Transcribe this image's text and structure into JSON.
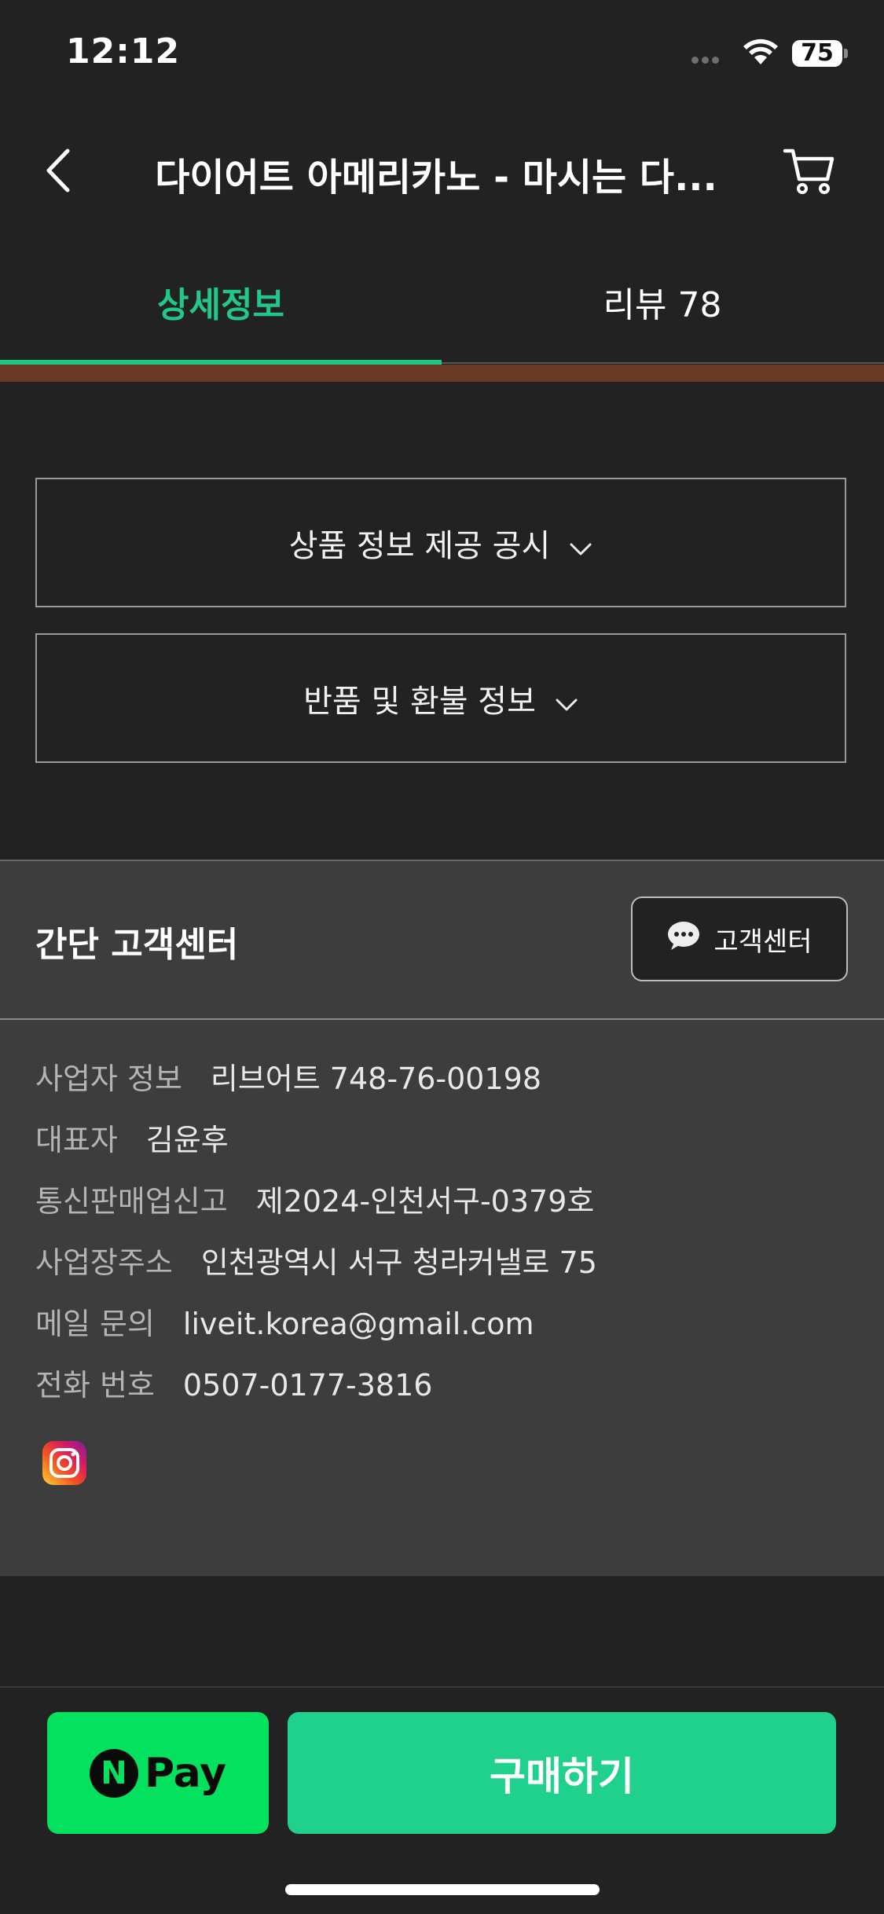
{
  "status_bar": {
    "time": "12:12",
    "battery": "75"
  },
  "header": {
    "title": "다이어트 아메리카노 - 마시는 다..."
  },
  "tabs": [
    {
      "label": "상세정보",
      "active": true
    },
    {
      "label": "리뷰 78",
      "active": false
    }
  ],
  "accordions": [
    {
      "label": "상품 정보 제공 공시"
    },
    {
      "label": "반품 및 환불 정보"
    }
  ],
  "customer_center": {
    "title": "간단 고객센터",
    "button_label": "고객센터"
  },
  "business_info": [
    {
      "label": "사업자 정보",
      "value": "리브어트 748-76-00198"
    },
    {
      "label": "대표자",
      "value": "김윤후"
    },
    {
      "label": "통신판매업신고",
      "value": "제2024-인천서구-0379호"
    },
    {
      "label": "사업장주소",
      "value": "인천광역시 서구 청라커낼로 75"
    },
    {
      "label": "메일 문의",
      "value": "liveit.korea@gmail.com"
    },
    {
      "label": "전화 번호",
      "value": "0507-0177-3816"
    }
  ],
  "bottom_bar": {
    "npay_n": "N",
    "npay_label": "Pay",
    "buy_label": "구매하기"
  },
  "colors": {
    "accent": "#22c78a",
    "buy_button": "#1fd18d",
    "npay_button": "#03e15e",
    "background": "#222222"
  }
}
